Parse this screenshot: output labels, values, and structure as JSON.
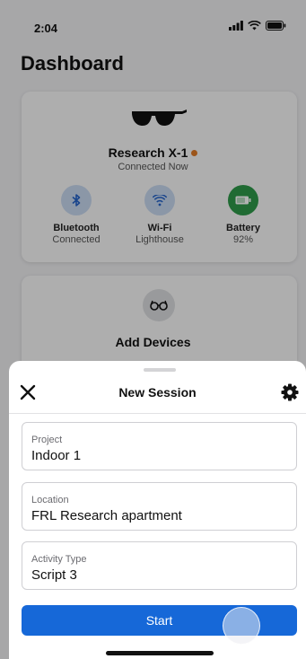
{
  "status_bar": {
    "time": "2:04"
  },
  "dashboard": {
    "title": "Dashboard",
    "device": {
      "name": "Research X-1",
      "status": "Connected Now",
      "status_dot_color": "#e07a26",
      "icon": "glasses-icon"
    },
    "stats": [
      {
        "label": "Bluetooth",
        "value": "Connected",
        "icon": "bluetooth-icon",
        "color": "#c7d8f0"
      },
      {
        "label": "Wi-Fi",
        "value": "Lighthouse",
        "icon": "wifi-icon",
        "color": "#c7d8f0"
      },
      {
        "label": "Battery",
        "value": "92%",
        "icon": "battery-icon",
        "color": "#2f9a4a"
      }
    ],
    "add_devices": {
      "title": "Add Devices",
      "icon": "glasses-outline-icon"
    }
  },
  "sheet": {
    "title": "New Session",
    "close_icon": "close-icon",
    "settings_icon": "gear-icon",
    "fields": [
      {
        "label": "Project",
        "value": "Indoor 1"
      },
      {
        "label": "Location",
        "value": "FRL Research apartment"
      },
      {
        "label": "Activity Type",
        "value": "Script 3"
      }
    ],
    "start_label": "Start",
    "accent_color": "#1668d8"
  }
}
